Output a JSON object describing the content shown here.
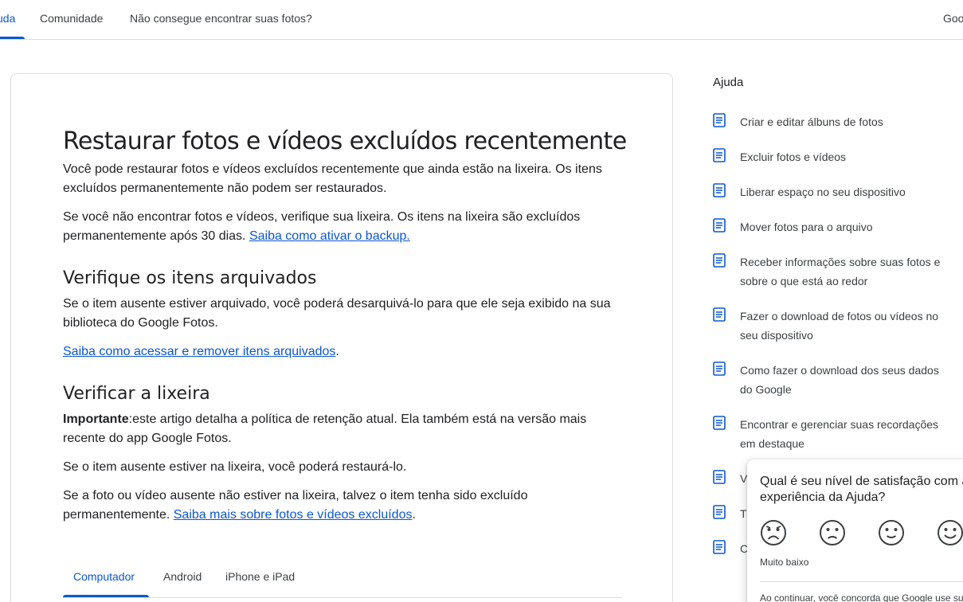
{
  "topnav": {
    "tabs": [
      "uda",
      "Comunidade",
      "Não consegue encontrar suas fotos?"
    ],
    "right": "Goo"
  },
  "article": {
    "title": "Restaurar fotos e vídeos excluídos recentemente",
    "p1": "Você pode restaurar fotos e vídeos excluídos recentemente que ainda estão na lixeira. Os itens excluídos permanentemente não podem ser restaurados.",
    "p2_text": "Se você não encontrar fotos e vídeos, verifique sua lixeira. Os itens na lixeira são excluídos permanentemente após 30 dias. ",
    "p2_link": "Saiba como ativar o backup.",
    "h2_archived": "Verifique os itens arquivados",
    "p3": "Se o item ausente estiver arquivado, você poderá desarquivá-lo para que ele seja exibido na sua biblioteca do Google Fotos.",
    "p4_link": "Saiba como acessar e remover itens arquivados",
    "p4_after": ".",
    "h2_trash": "Verificar a lixeira",
    "p5_bold": "Importante",
    "p5_text": ":este artigo detalha a política de retenção atual. Ela também está na versão mais recente do app Google Fotos.",
    "p6": "Se o item ausente estiver na lixeira, você poderá restaurá-lo.",
    "p7_text": "Se a foto ou vídeo ausente não estiver na lixeira, talvez o item tenha sido excluído permanentemente. ",
    "p7_link": "Saiba mais sobre fotos e vídeos excluídos",
    "p7_after": ".",
    "tabs": [
      "Computador",
      "Android",
      "iPhone e iPad"
    ]
  },
  "sidebar": {
    "heading": "Ajuda",
    "items": [
      "Criar e editar álbuns de fotos",
      "Excluir fotos e vídeos",
      "Liberar espaço no seu dispositivo",
      "Mover fotos para o arquivo",
      "Receber informações sobre suas fotos e sobre o que está ao redor",
      "Fazer o download de fotos ou vídeos no seu dispositivo",
      "Como fazer o download dos seus dados do Google",
      "Encontrar e gerenciar suas recordações em destaque",
      "Ve",
      "Tr p",
      "C P"
    ]
  },
  "survey": {
    "question": "Qual é seu nível de satisfação com a experiência da Ajuda?",
    "low_label": "Muito baixo",
    "footer": "Ao continuar, você concorda que Google use su"
  },
  "colors": {
    "accent": "#0b57d0",
    "text": "#202124",
    "border": "#dadce0"
  }
}
